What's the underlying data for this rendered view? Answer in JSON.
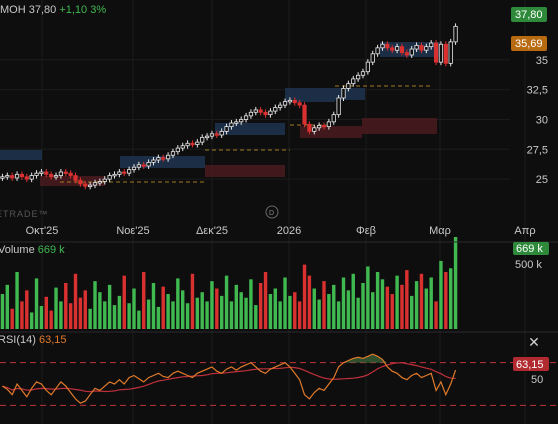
{
  "header": {
    "symbol_text": "MOH",
    "price": "37,80",
    "change": "+1,10 3%"
  },
  "watermark": "ETRADE™",
  "volume_panel": {
    "label": "Volume",
    "value": "669 k",
    "badge": "669 k",
    "axis_tick": "500 k"
  },
  "rsi_panel": {
    "label": "RSI(14)",
    "value": "63,15",
    "badge": "63,15",
    "axis_tick": "50"
  },
  "price_badges": {
    "last": "37,80",
    "level": "35,69"
  },
  "colors": {
    "up": "#3fb950",
    "down": "#d93030",
    "rsi_line": "#e07a2a",
    "rsi_ma": "#c0303a",
    "zone_blue": "#1e3350",
    "zone_red": "#4a1a1e",
    "badge_green": "#2e8a3a",
    "badge_orange": "#b86a10",
    "badge_red": "#b02a30"
  },
  "icons": {
    "close": "close-icon",
    "logo": "broker-logo-icon"
  },
  "chart_data": [
    {
      "type": "candlestick",
      "x_ticks": [
        "Οκτ'25",
        "Νοε'25",
        "Δεκ'25",
        "2026",
        "Φεβ",
        "Μαρ",
        "Απρ"
      ],
      "y_ticks": [
        "35",
        "32,5",
        "30",
        "27,5",
        "25"
      ],
      "ylim": [
        23.0,
        38.5
      ],
      "grid": true,
      "last_price": 37.8,
      "marked_level": 35.69,
      "closes": [
        25.2,
        25.3,
        25.1,
        25.4,
        25.2,
        25.0,
        25.3,
        25.5,
        25.6,
        25.4,
        25.2,
        25.3,
        25.6,
        25.5,
        25.3,
        24.9,
        24.6,
        24.4,
        24.5,
        24.7,
        24.8,
        25.0,
        25.3,
        25.4,
        25.6,
        25.5,
        25.8,
        26.0,
        26.2,
        26.1,
        26.4,
        26.6,
        26.8,
        26.7,
        27.0,
        27.3,
        27.6,
        27.8,
        28.0,
        27.9,
        28.1,
        28.5,
        28.6,
        28.8,
        28.7,
        29.0,
        29.4,
        29.7,
        29.8,
        30.0,
        30.3,
        30.6,
        30.8,
        30.6,
        30.4,
        30.7,
        31.0,
        31.2,
        31.5,
        31.6,
        31.4,
        31.2,
        29.6,
        29.0,
        29.3,
        29.5,
        29.4,
        29.8,
        30.4,
        31.8,
        32.6,
        33.0,
        33.4,
        33.7,
        34.0,
        34.8,
        35.5,
        36.0,
        36.3,
        36.0,
        35.8,
        36.1,
        35.6,
        35.4,
        35.9,
        36.2,
        35.8,
        36.1,
        36.4,
        34.8,
        36.3,
        34.7,
        36.5,
        37.8
      ]
    },
    {
      "type": "bar",
      "name": "Volume",
      "value_label": "669 k",
      "values": [
        0.38,
        0.48,
        0.22,
        0.62,
        0.3,
        0.42,
        0.18,
        0.55,
        0.25,
        0.35,
        0.2,
        0.45,
        0.3,
        0.5,
        0.28,
        0.6,
        0.34,
        0.42,
        0.22,
        0.52,
        0.4,
        0.3,
        0.48,
        0.26,
        0.36,
        0.58,
        0.28,
        0.44,
        0.2,
        0.62,
        0.32,
        0.5,
        0.24,
        0.46,
        0.38,
        0.3,
        0.55,
        0.42,
        0.28,
        0.6,
        0.34,
        0.4,
        0.3,
        0.52,
        0.44,
        0.36,
        0.58,
        0.3,
        0.48,
        0.4,
        0.34,
        0.54,
        0.26,
        0.5,
        0.62,
        0.38,
        0.44,
        0.3,
        0.56,
        0.36,
        0.4,
        0.3,
        0.7,
        0.58,
        0.44,
        0.32,
        0.52,
        0.38,
        0.48,
        0.3,
        0.56,
        0.42,
        0.6,
        0.34,
        0.5,
        0.68,
        0.4,
        0.62,
        0.54,
        0.46,
        0.38,
        0.58,
        0.48,
        0.64,
        0.36,
        0.52,
        0.6,
        0.44,
        0.56,
        0.3,
        0.74,
        0.62,
        0.66,
        1.0
      ]
    },
    {
      "type": "line",
      "name": "RSI(14)",
      "value_label": "63,15",
      "ylim": [
        20,
        80
      ],
      "y_ticks": [
        "50"
      ],
      "values": [
        48,
        45,
        40,
        50,
        44,
        38,
        46,
        52,
        50,
        44,
        40,
        46,
        52,
        48,
        42,
        36,
        32,
        34,
        40,
        46,
        44,
        48,
        52,
        50,
        54,
        50,
        56,
        58,
        55,
        52,
        56,
        58,
        60,
        57,
        56,
        60,
        62,
        60,
        58,
        56,
        60,
        62,
        64,
        66,
        62,
        60,
        64,
        66,
        63,
        66,
        68,
        70,
        66,
        62,
        60,
        64,
        66,
        68,
        70,
        66,
        60,
        54,
        40,
        36,
        42,
        46,
        44,
        50,
        56,
        66,
        70,
        72,
        74,
        75,
        74,
        76,
        78,
        76,
        73,
        66,
        62,
        60,
        56,
        54,
        58,
        60,
        56,
        58,
        60,
        44,
        52,
        40,
        50,
        63
      ]
    }
  ]
}
